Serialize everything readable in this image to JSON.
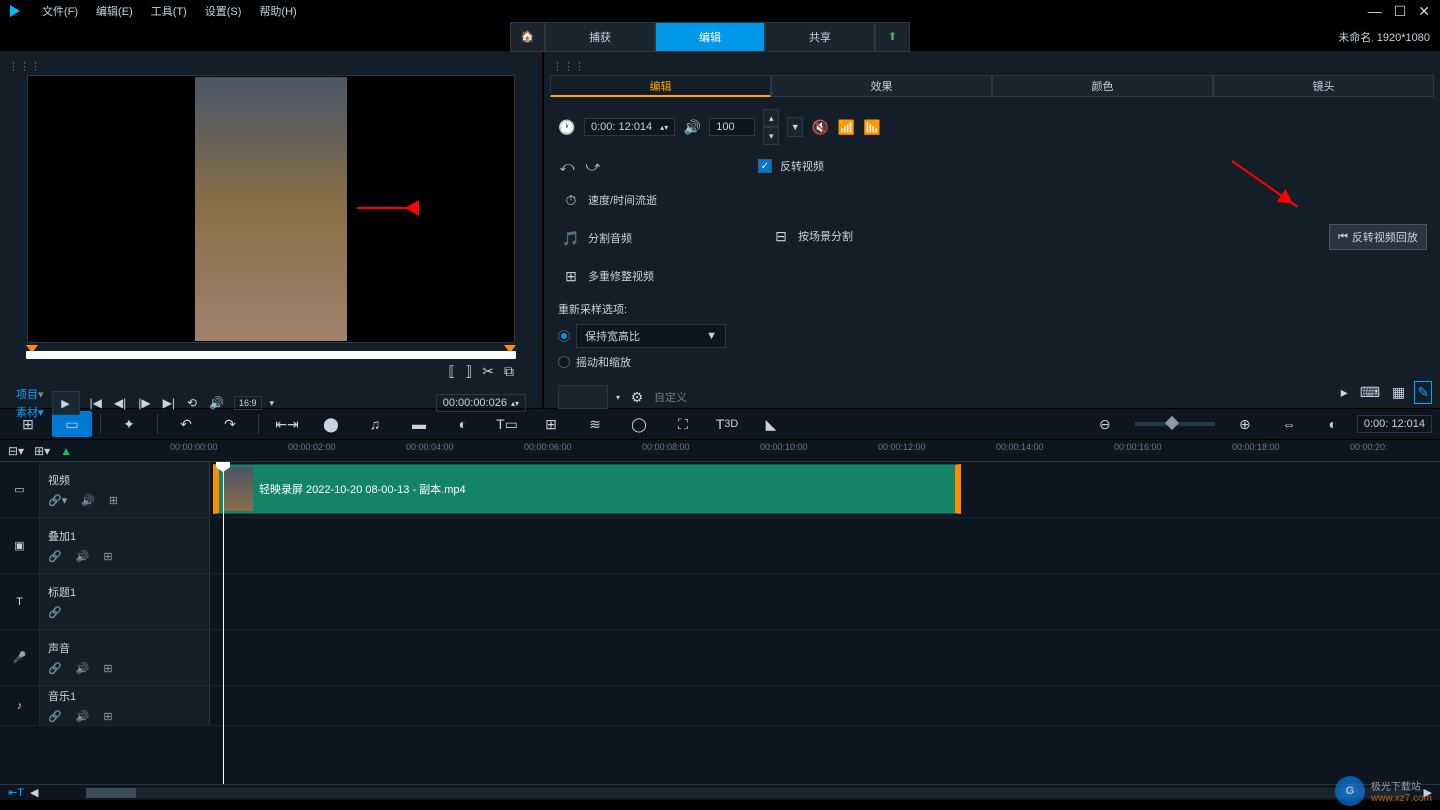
{
  "menu": {
    "file": "文件(F)",
    "edit": "编辑(E)",
    "tools": "工具(T)",
    "settings": "设置(S)",
    "help": "帮助(H)"
  },
  "project": {
    "name": "未命名",
    "resolution": "1920*1080"
  },
  "maintabs": {
    "capture": "捕获",
    "edit": "编辑",
    "share": "共享"
  },
  "opttabs": {
    "edit": "编辑",
    "effect": "效果",
    "color": "颜色",
    "lens": "镜头"
  },
  "duration": "0:00: 12:014",
  "volume": "100",
  "reverse": "反转视频",
  "reverse_tip": "反转视频回放",
  "items": {
    "speed": "速度/时间流逝",
    "split_audio": "分割音频",
    "multi_trim": "多重修整视频",
    "scene_split": "按场景分割"
  },
  "resample": {
    "label": "重新采样选项:",
    "keep": "保持宽高比",
    "pan": "摇动和缩放",
    "custom": "自定义"
  },
  "playback": {
    "project": "项目",
    "material": "素材",
    "aspect": "16:9",
    "timecode": "00:00:00:026"
  },
  "timecode_right": "0:00: 12:014",
  "ruler": [
    "00:00:00:00",
    "00:00:02:00",
    "00:00:04:00",
    "00:00:06:00",
    "00:00:08:00",
    "00:00:10:00",
    "00:00:12:00",
    "00:00:14:00",
    "00:00:16:00",
    "00:00:18:00",
    "00:00:20:"
  ],
  "tracks": {
    "video": "视频",
    "overlay": "叠加1",
    "title": "标题1",
    "sound": "声音",
    "music": "音乐1"
  },
  "clip": "轻映录屏 2022-10-20 08-00-13 - 副本.mp4",
  "watermark": {
    "name": "极光下载站",
    "url": "www.xz7.com"
  }
}
